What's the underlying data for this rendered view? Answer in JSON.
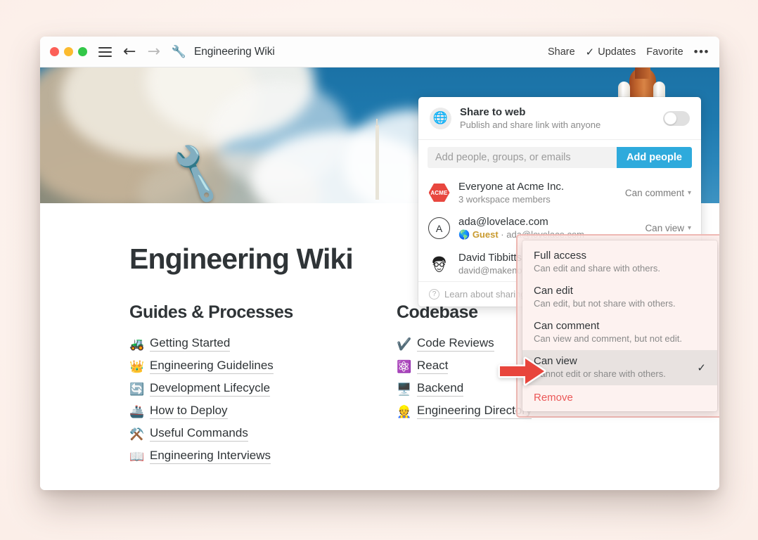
{
  "titlebar": {
    "traffic_lights": [
      "close",
      "minimize",
      "maximize"
    ],
    "back_arrow": "←",
    "forward_arrow": "→",
    "doc_emoji": "🔧",
    "doc_title": "Engineering Wiki",
    "share_label": "Share",
    "updates_check": "✓",
    "updates_label": "Updates",
    "favorite_label": "Favorite",
    "more_label": "•••"
  },
  "hero": {
    "cover_description": "space-shuttle-launch-cover",
    "page_emoji": "🔧"
  },
  "document": {
    "heading": "Engineering Wiki",
    "columns": [
      {
        "title": "Guides & Processes",
        "links": [
          {
            "emoji": "🚜",
            "label": "Getting Started"
          },
          {
            "emoji": "👑",
            "label": "Engineering Guidelines"
          },
          {
            "emoji": "🔄",
            "label": "Development Lifecycle"
          },
          {
            "emoji": "🚢",
            "label": "How to Deploy"
          },
          {
            "emoji": "⚒️",
            "label": "Useful Commands"
          },
          {
            "emoji": "📖",
            "label": "Engineering Interviews"
          }
        ]
      },
      {
        "title": "Codebase",
        "links": [
          {
            "emoji": "✔️",
            "label": "Code Reviews"
          },
          {
            "emoji": "⚛️",
            "label": "React"
          },
          {
            "emoji": "🖥️",
            "label": "Backend"
          },
          {
            "emoji": "👷",
            "label": "Engineering Directory"
          }
        ]
      }
    ],
    "help_button": "?"
  },
  "share_panel": {
    "share_to_web": {
      "icon": "globe-icon",
      "title": "Share to web",
      "subtitle": "Publish and share link with anyone",
      "toggle_state": "off"
    },
    "invite": {
      "placeholder": "Add people, groups, or emails",
      "value": "",
      "button_label": "Add people",
      "button_color": "#2eaadc"
    },
    "people": [
      {
        "avatar_type": "acme-hex-badge",
        "avatar_text": "ACME",
        "name": "Everyone at Acme Inc.",
        "sub": "3 workspace members",
        "permission": "Can comment"
      },
      {
        "avatar_type": "letter-circle",
        "avatar_text": "A",
        "name": "ada@lovelace.com",
        "sub_badge": "Guest",
        "sub_separator": "·",
        "sub": "ada@lovelace.com",
        "permission": "Can view"
      },
      {
        "avatar_type": "photo-face",
        "avatar_text": "",
        "name": "David Tibbitts",
        "sub": "david@makenoti",
        "permission": ""
      }
    ],
    "footer": {
      "icon": "question-circle-icon",
      "label": "Learn about sharing"
    }
  },
  "permission_menu": {
    "items": [
      {
        "title": "Full access",
        "desc": "Can edit and share with others.",
        "selected": false
      },
      {
        "title": "Can edit",
        "desc": "Can edit, but not share with others.",
        "selected": false
      },
      {
        "title": "Can comment",
        "desc": "Can view and comment, but not edit.",
        "selected": false
      },
      {
        "title": "Can view",
        "desc": "Cannot edit or share with others.",
        "selected": true
      }
    ],
    "checkmark": "✓",
    "remove_label": "Remove",
    "remove_color": "#eb5757",
    "highlight_color": "#f0b9b4"
  },
  "annotation": {
    "type": "arrow-right",
    "color": "#e8453c"
  }
}
